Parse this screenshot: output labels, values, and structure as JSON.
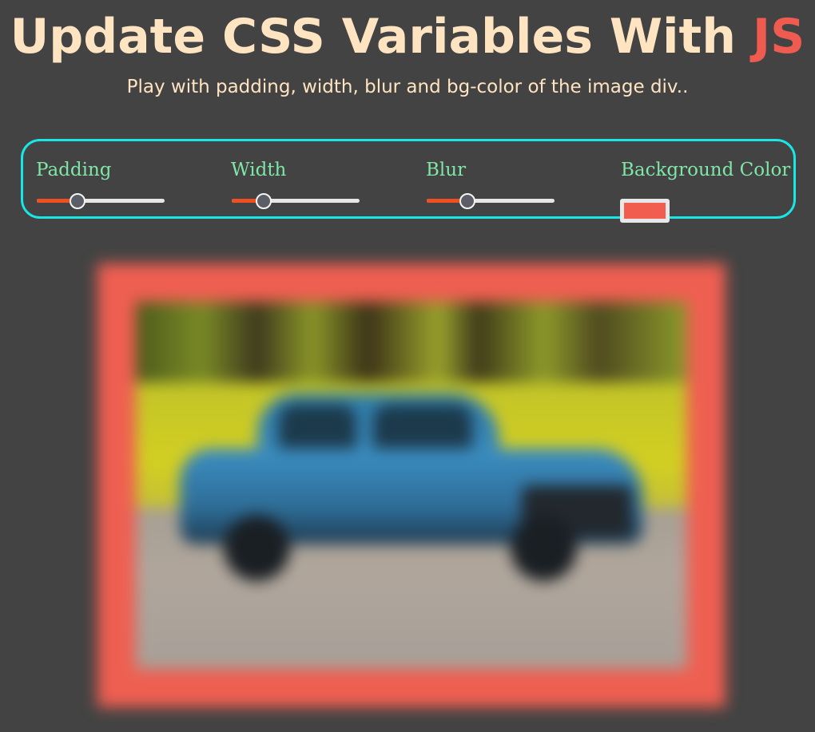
{
  "header": {
    "title_main": "Update CSS Variables With ",
    "title_accent": "JS",
    "subtitle": "Play with padding, width, blur and bg-color of the image div.."
  },
  "controls": {
    "padding": {
      "label": "Padding",
      "value_fraction": 0.32
    },
    "width": {
      "label": "Width",
      "value_fraction": 0.25
    },
    "blur": {
      "label": "Blur",
      "value_fraction": 0.32
    },
    "background_color": {
      "label": "Background Color",
      "value": "#f15d4f"
    }
  },
  "image": {
    "description_icon": "car-photo-icon"
  },
  "colors": {
    "page_bg": "#434343",
    "title": "#ffe4c1",
    "accent": "#ef5b4e",
    "control_label": "#7fe6a8",
    "panel_border": "#19e6e6",
    "slider_fill": "#f04f22",
    "frame_bg": "#ef5f51"
  }
}
